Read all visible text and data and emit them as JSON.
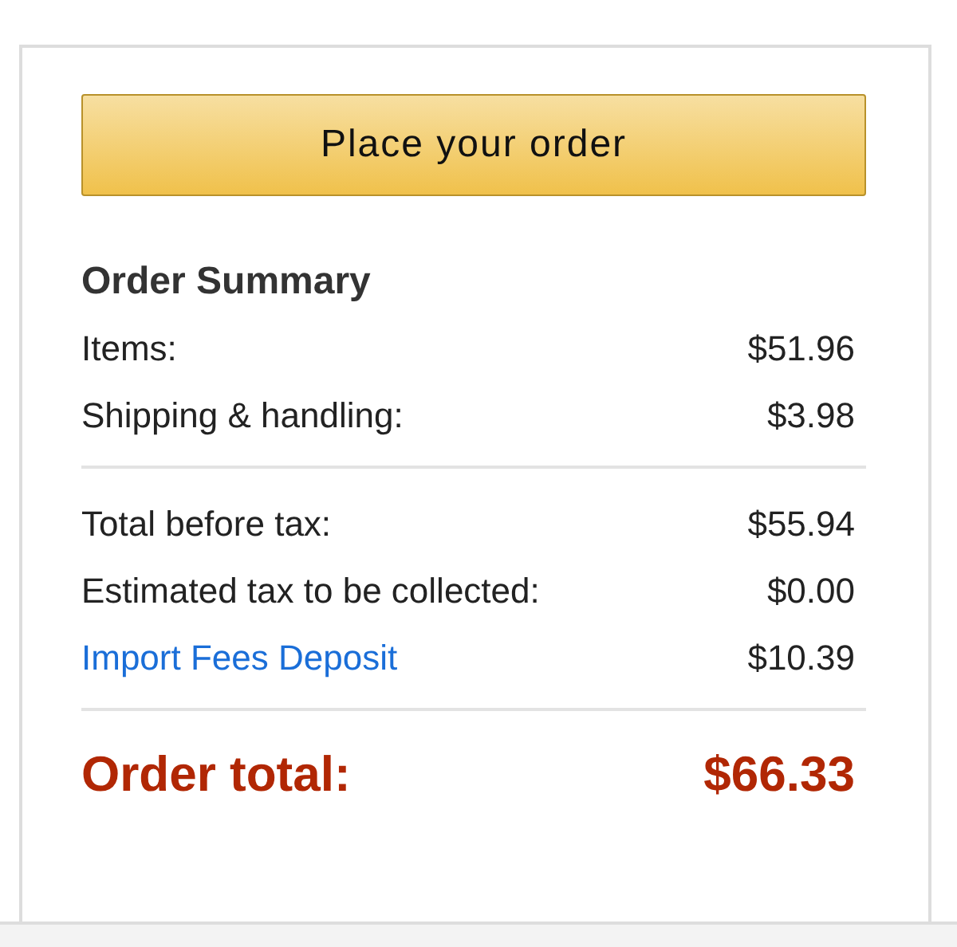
{
  "place_order_button": {
    "label": "Place your order"
  },
  "summary": {
    "title": "Order Summary",
    "sections": [
      {
        "rows": [
          {
            "kind": "plain",
            "label": "Items:",
            "amount": "$51.96"
          },
          {
            "kind": "plain",
            "label": "Shipping & handling:",
            "amount": "$3.98"
          }
        ]
      },
      {
        "rows": [
          {
            "kind": "plain",
            "label": "Total before tax:",
            "amount": "$55.94"
          },
          {
            "kind": "plain",
            "label": "Estimated tax to be collected:",
            "amount": "$0.00"
          },
          {
            "kind": "link",
            "label": "Import Fees Deposit",
            "amount": "$10.39"
          }
        ]
      }
    ],
    "total": {
      "label": "Order total:",
      "amount": "$66.33"
    }
  }
}
